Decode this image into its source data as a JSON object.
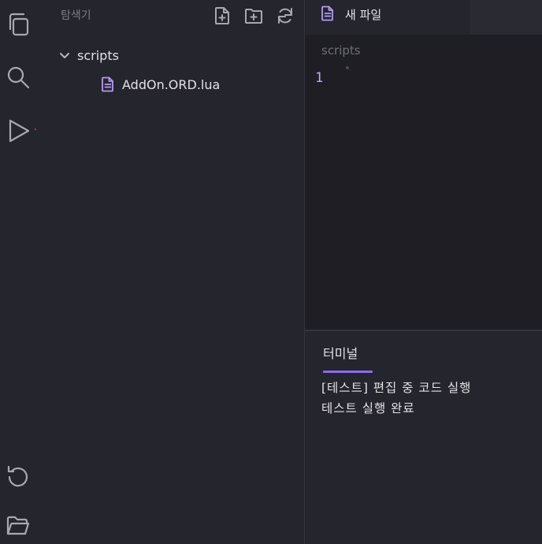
{
  "activity_bar": {
    "icons": [
      "copy-icon",
      "search-icon",
      "play-icon",
      "history-icon",
      "folder-open-icon"
    ]
  },
  "explorer": {
    "title": "탐색기",
    "actions": [
      "new-file-icon",
      "new-folder-icon",
      "refresh-icon"
    ],
    "tree": {
      "folder": "scripts",
      "files": [
        "AddOn.ORD.lua"
      ]
    }
  },
  "annotation": {
    "arrow_color": "#e02424"
  },
  "editor": {
    "tab_label": "새 파일",
    "breadcrumb": "scripts",
    "line_numbers": [
      "1"
    ],
    "accent": "#c4a7ff"
  },
  "terminal": {
    "tab_label": "터미널",
    "lines": [
      "[테스트] 편집 중 코드 실행",
      "테스트 실행 완료"
    ],
    "accent": "#8c6cf0"
  }
}
